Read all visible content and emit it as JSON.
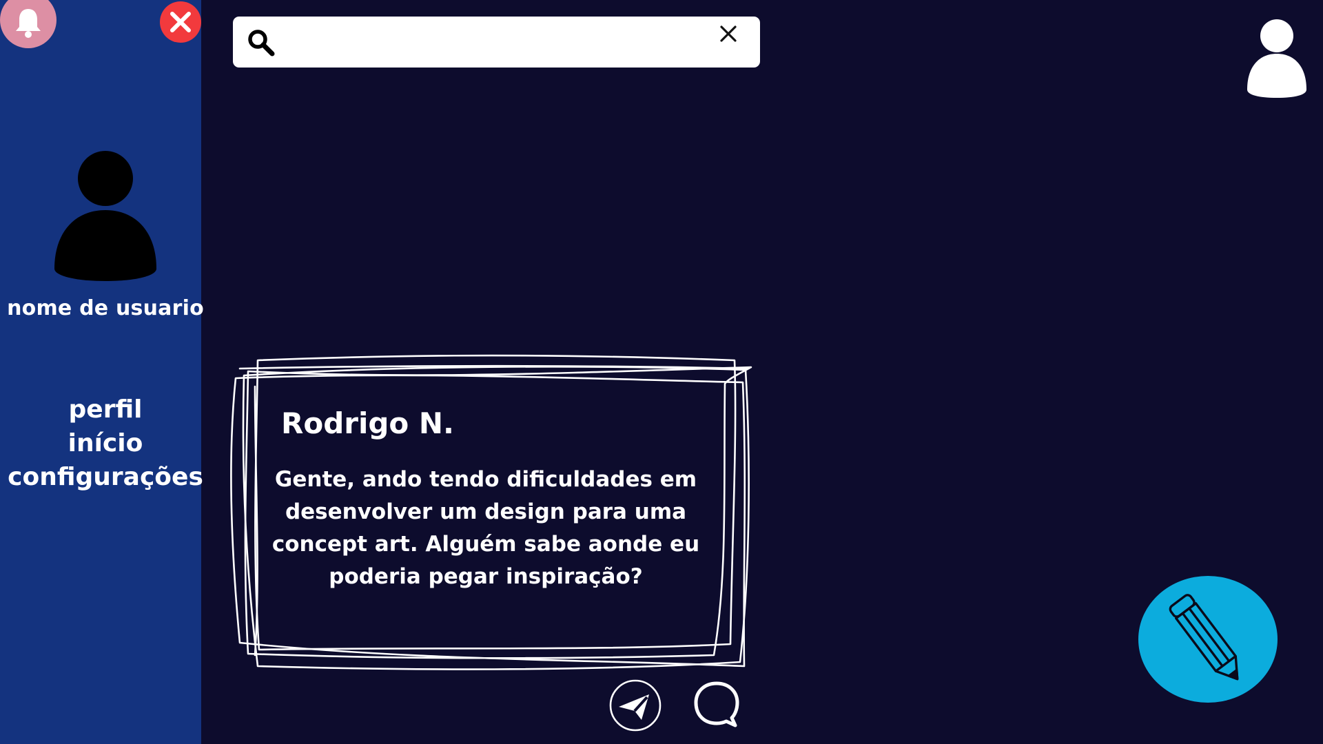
{
  "sidebar": {
    "username": "nome de usuario",
    "nav": [
      {
        "label": "perfil"
      },
      {
        "label": "início"
      },
      {
        "label": "configurações"
      }
    ]
  },
  "search": {
    "value": "",
    "placeholder": ""
  },
  "post": {
    "author": "Rodrigo N.",
    "body": "Gente, ando tendo dificuldades em desenvolver um design para uma concept art. Alguém sabe aonde eu poderia pegar inspiração?"
  },
  "colors": {
    "background": "#0d0c2d",
    "sidebar": "#14337f",
    "notification": "#dd8fa4",
    "close": "#f23a3d",
    "compose": "#0cacdd"
  },
  "icons": [
    "bell-icon",
    "close-icon",
    "user-avatar-icon",
    "search-icon",
    "clear-icon",
    "profile-icon",
    "send-icon",
    "comment-icon",
    "pencil-icon"
  ]
}
